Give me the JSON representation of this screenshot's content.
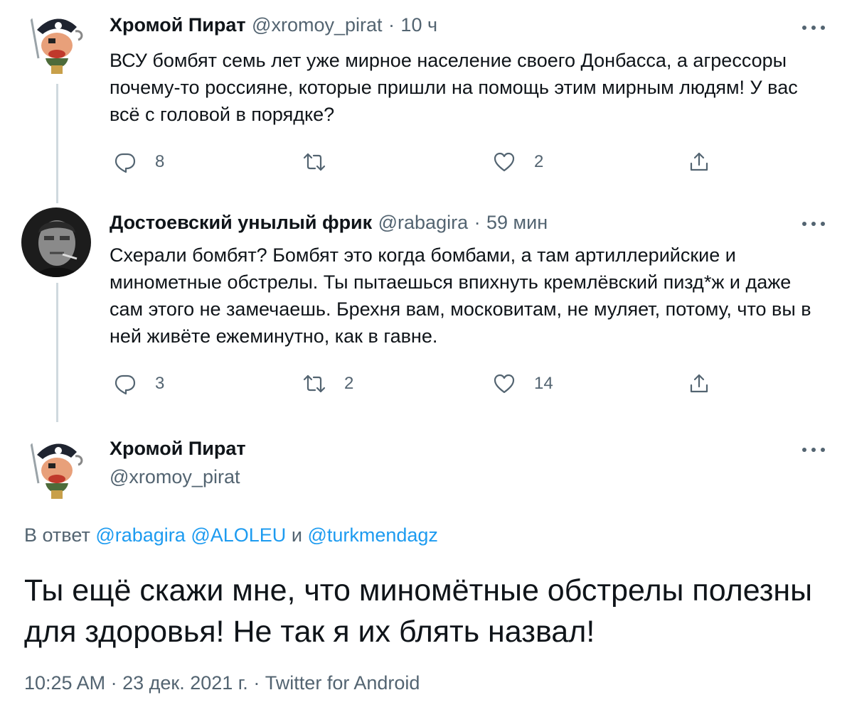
{
  "tweet1": {
    "name": "Хромой Пират",
    "handle": "@xromoy_pirat",
    "sep": "·",
    "time": "10 ч",
    "text": "ВСУ бомбят семь лет уже мирное население своего Донбасса, а агрессоры почему-то россияне, которые пришли на помощь этим мирным людям! У вас всё с головой в порядке?",
    "replies": "8",
    "retweets": "",
    "likes": "2"
  },
  "tweet2": {
    "name": "Достоевский унылый фрик",
    "handle": "@rabagira",
    "sep": "·",
    "time": "59 мин",
    "text": "Схерали бомбят? Бомбят это когда бомбами, а там артиллерийские и минометные обстрелы. Ты пытаешься впихнуть кремлёвский пизд*ж и даже сам этого не замечаешь. Брехня вам, московитам, не муляет, потому, что вы в ней живёте ежеминутно, как в гавне.",
    "replies": "3",
    "retweets": "2",
    "likes": "14"
  },
  "main_tweet": {
    "name": "Хромой Пират",
    "handle": "@xromoy_pirat",
    "reply_prefix": "В ответ",
    "reply_to_1": "@rabagira",
    "reply_to_2": "@ALOLEU",
    "reply_and": "и",
    "reply_to_3": "@turkmendagz",
    "text": "Ты ещё скажи мне, что миномётные обстрелы полезны для здоровья! Не так я их блять назвал!",
    "meta": "10:25 AM · 23 дек. 2021 г. · Twitter for Android"
  },
  "icons": {
    "reply": "reply-icon",
    "retweet": "retweet-icon",
    "like": "heart-icon",
    "share": "share-icon",
    "more": "more-dots-icon"
  },
  "colors": {
    "text": "#0f1419",
    "secondary": "#536471",
    "link": "#1d9bf0",
    "thread_line": "#cfd9de"
  }
}
